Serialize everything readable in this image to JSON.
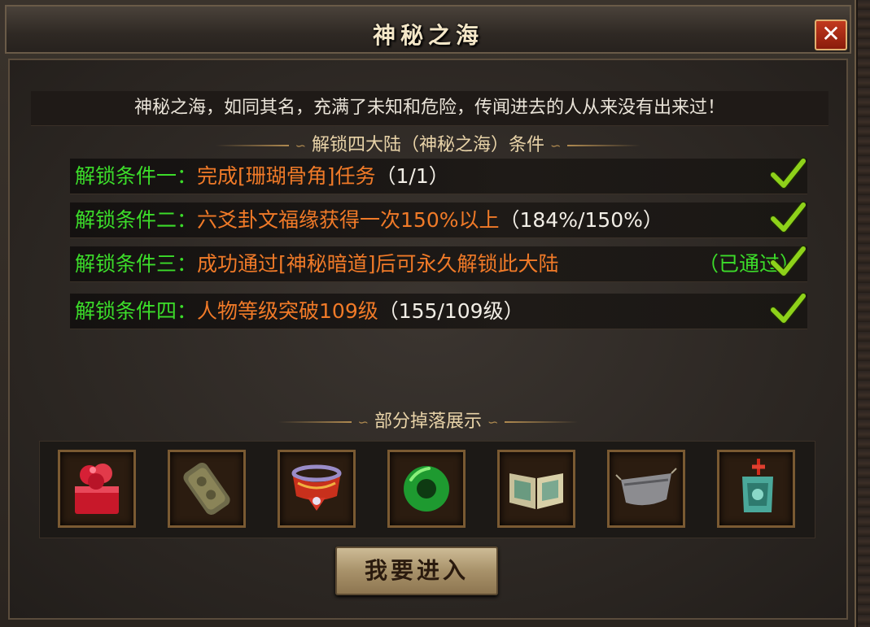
{
  "window": {
    "title": "神秘之海",
    "close_glyph": "✕"
  },
  "intro_text": "神秘之海，如同其名，充满了未知和危险，传闻进去的人从来没有出来过！",
  "conditions_header": "解锁四大陆（神秘之海）条件",
  "conditions": [
    {
      "label": "解锁条件一：",
      "desc": "完成[珊瑚骨角]任务",
      "progress": "（1/1）",
      "completed": true
    },
    {
      "label": "解锁条件二：",
      "desc": "六爻卦文福缘获得一次150%以上",
      "progress": "（184%/150%）",
      "completed": true
    },
    {
      "label": "解锁条件三：",
      "desc": "成功通过[神秘暗道]后可永久解锁此大陆",
      "progress": "",
      "status": "（已通过）",
      "completed": true
    },
    {
      "label": "解锁条件四：",
      "desc": "人物等级突破109级",
      "progress": "（155/109级）",
      "completed": true
    }
  ],
  "drops_header": "部分掉落展示",
  "drops": [
    {
      "icon": "red-seal-icon"
    },
    {
      "icon": "stone-tablet-icon"
    },
    {
      "icon": "red-belt-icon"
    },
    {
      "icon": "jade-ring-icon"
    },
    {
      "icon": "open-book-icon"
    },
    {
      "icon": "gray-mask-icon"
    },
    {
      "icon": "jade-pendant-icon"
    }
  ],
  "enter_button": "我要进入",
  "colors": {
    "condition_label": "#3cdc2a",
    "condition_desc": "#f07a28",
    "progress_text": "#f2eee6",
    "check": "#8ed21a"
  }
}
